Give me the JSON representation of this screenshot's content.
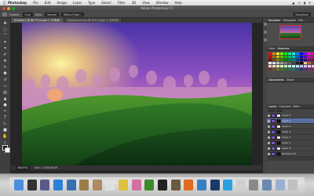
{
  "menubar": {
    "apple_icon": "apple-icon",
    "items": [
      {
        "label": "Photoshop"
      },
      {
        "label": "File"
      },
      {
        "label": "Edit"
      },
      {
        "label": "Image"
      },
      {
        "label": "Layer"
      },
      {
        "label": "Type"
      },
      {
        "label": "Select"
      },
      {
        "label": "Filter"
      },
      {
        "label": "3D"
      },
      {
        "label": "View"
      },
      {
        "label": "Window"
      },
      {
        "label": "Help"
      }
    ]
  },
  "window": {
    "title": "Adobe Photoshop CC"
  },
  "options_bar": {
    "feather_label": "Feather:",
    "feather_value": "0 px",
    "style_label": "Style:",
    "style_value": "Normal",
    "refine_edge": "Refine Edge...",
    "workspace": "Essentials"
  },
  "tabs": [
    {
      "label": "Untitled-1 @ 66.7% (Layer 1, RGB/8)"
    },
    {
      "label": "background.psd @ 50% (Layer 4, RGB/8)"
    }
  ],
  "status": {
    "zoom": "66.67%",
    "doc": "Doc: 4.12M/28.4M"
  },
  "panels": {
    "top_tabs": [
      "Navigator",
      "Histogram",
      "Info"
    ],
    "color_tabs": [
      "Color",
      "Swatches"
    ],
    "adjust_tabs": [
      "Adjustments",
      "Styles"
    ],
    "layer_tabs": [
      "Layers",
      "Channels",
      "Paths"
    ],
    "swatch_colors": [
      "#ff0000",
      "#ff7f00",
      "#ffff00",
      "#7fff00",
      "#00ff00",
      "#00ff7f",
      "#00ffff",
      "#007fff",
      "#0000ff",
      "#7f00ff",
      "#ff00ff",
      "#ff007f",
      "#c00000",
      "#c06000",
      "#c0c000",
      "#60c000",
      "#00c000",
      "#00c060",
      "#00c0c0",
      "#0060c0",
      "#0000c0",
      "#6000c0",
      "#c000c0",
      "#c00060",
      "#800000",
      "#804000",
      "#808000",
      "#408000",
      "#008000",
      "#008040",
      "#008080",
      "#004080",
      "#000080",
      "#400080",
      "#800080",
      "#800040",
      "#ffffff",
      "#e0e0e0",
      "#c0c0c0",
      "#a0a0a0",
      "#808080",
      "#606060",
      "#404040",
      "#202020",
      "#000000",
      "#f4c4a0",
      "#a07050",
      "#604030",
      "#ffcccc",
      "#ffe0c0",
      "#ffffc0",
      "#e0ffc0",
      "#c0ffc0",
      "#c0ffe0",
      "#c0ffff",
      "#c0e0ff",
      "#c0c0ff",
      "#e0c0ff",
      "#ffc0ff",
      "#ffc0e0",
      "#703030",
      "#705030",
      "#707030",
      "#507030",
      "#307030",
      "#307050",
      "#307070",
      "#305070",
      "#303070",
      "#503070",
      "#703070",
      "#703050"
    ],
    "layers": [
      {
        "name": "Layer 6",
        "selected": false
      },
      {
        "name": "Layer 5",
        "selected": true
      },
      {
        "name": "Layer 4",
        "selected": false
      },
      {
        "name": "Layer 3",
        "selected": false
      },
      {
        "name": "Layer 2",
        "selected": false
      },
      {
        "name": "Layer 1",
        "selected": false
      },
      {
        "name": "Layer 0",
        "selected": false
      },
      {
        "name": "Background",
        "selected": false
      }
    ]
  },
  "tools": [
    "move-tool-icon",
    "marquee-tool-icon",
    "lasso-tool-icon",
    "quick-select-tool-icon",
    "crop-tool-icon",
    "eyedropper-tool-icon",
    "spot-heal-tool-icon",
    "brush-tool-icon",
    "clone-stamp-tool-icon",
    "history-brush-tool-icon",
    "eraser-tool-icon",
    "gradient-tool-icon",
    "blur-tool-icon",
    "dodge-tool-icon",
    "pen-tool-icon",
    "type-tool-icon",
    "path-select-tool-icon",
    "shape-tool-icon",
    "hand-tool-icon",
    "zoom-tool-icon"
  ],
  "dock": [
    {
      "name": "finder-icon",
      "color": "#4a8fe0"
    },
    {
      "name": "dashboard-icon",
      "color": "#333333"
    },
    {
      "name": "mission-control-icon",
      "color": "#5a5a8a"
    },
    {
      "name": "app-store-icon",
      "color": "#2d7fd9"
    },
    {
      "name": "preview-icon",
      "color": "#3a6fb0"
    },
    {
      "name": "photos-icon",
      "color": "#9a7b4a"
    },
    {
      "name": "contacts-icon",
      "color": "#b08a60"
    },
    {
      "name": "calendar-icon",
      "color": "#e0e0e0"
    },
    {
      "name": "notes-icon",
      "color": "#e0c040"
    },
    {
      "name": "itunes-icon",
      "color": "#d06fa0"
    },
    {
      "name": "spotify-icon",
      "color": "#3a8a2a"
    },
    {
      "name": "terminal-icon",
      "color": "#222222"
    },
    {
      "name": "chess-icon",
      "color": "#6a5a40"
    },
    {
      "name": "firefox-icon",
      "color": "#e06a20"
    },
    {
      "name": "safari-icon",
      "color": "#3a80c0"
    },
    {
      "name": "photoshop-icon",
      "color": "#1a3a6a"
    },
    {
      "name": "skype-icon",
      "color": "#2aa0e0"
    },
    {
      "name": "chrome-icon",
      "color": "#d0d0d0"
    },
    {
      "name": "system-prefs-icon",
      "color": "#8a8a8a"
    },
    {
      "name": "downloads-icon",
      "color": "#6a8ab0"
    },
    {
      "name": "documents-icon",
      "color": "#9ab0d0"
    },
    {
      "name": "trash-icon",
      "color": "#c0c0c0"
    }
  ]
}
